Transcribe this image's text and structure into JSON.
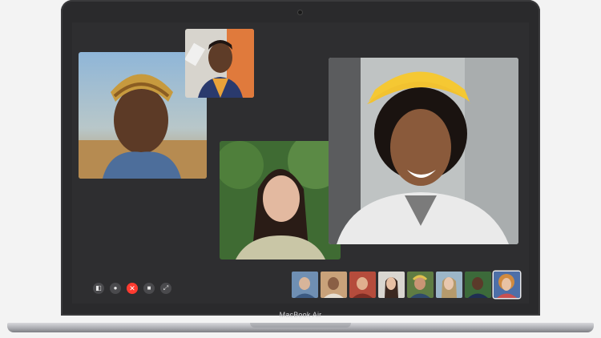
{
  "device": {
    "label": "MacBook Air"
  },
  "controls": [
    {
      "name": "sidebar-icon",
      "glyph": "◧"
    },
    {
      "name": "mute-icon",
      "glyph": "●"
    },
    {
      "name": "end-call-icon",
      "glyph": "✕"
    },
    {
      "name": "camera-icon",
      "glyph": "■"
    },
    {
      "name": "fullscreen-icon",
      "glyph": "⤢"
    }
  ],
  "colors": {
    "screen_bg": "#2e2e30",
    "end_call": "#ff3b30"
  }
}
